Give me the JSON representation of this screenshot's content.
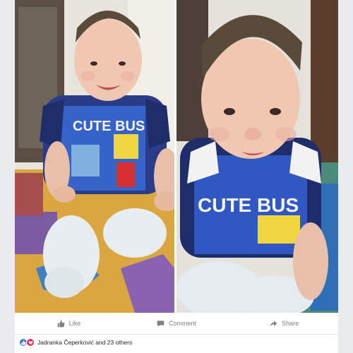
{
  "actions": {
    "like_label": "Like",
    "comment_label": "Comment",
    "share_label": "Share"
  },
  "reactions": {
    "summary": "Jadranka Čeperković and 23 others",
    "icons": [
      "like-icon",
      "love-icon"
    ]
  },
  "photos": {
    "left_shirt_text": "CUTE BUS",
    "right_shirt_text": "CUTE BUS"
  },
  "colors": {
    "action_text": "#7f7f7f",
    "like_blue": "#4a7bd1",
    "love_red": "#f0284a"
  }
}
